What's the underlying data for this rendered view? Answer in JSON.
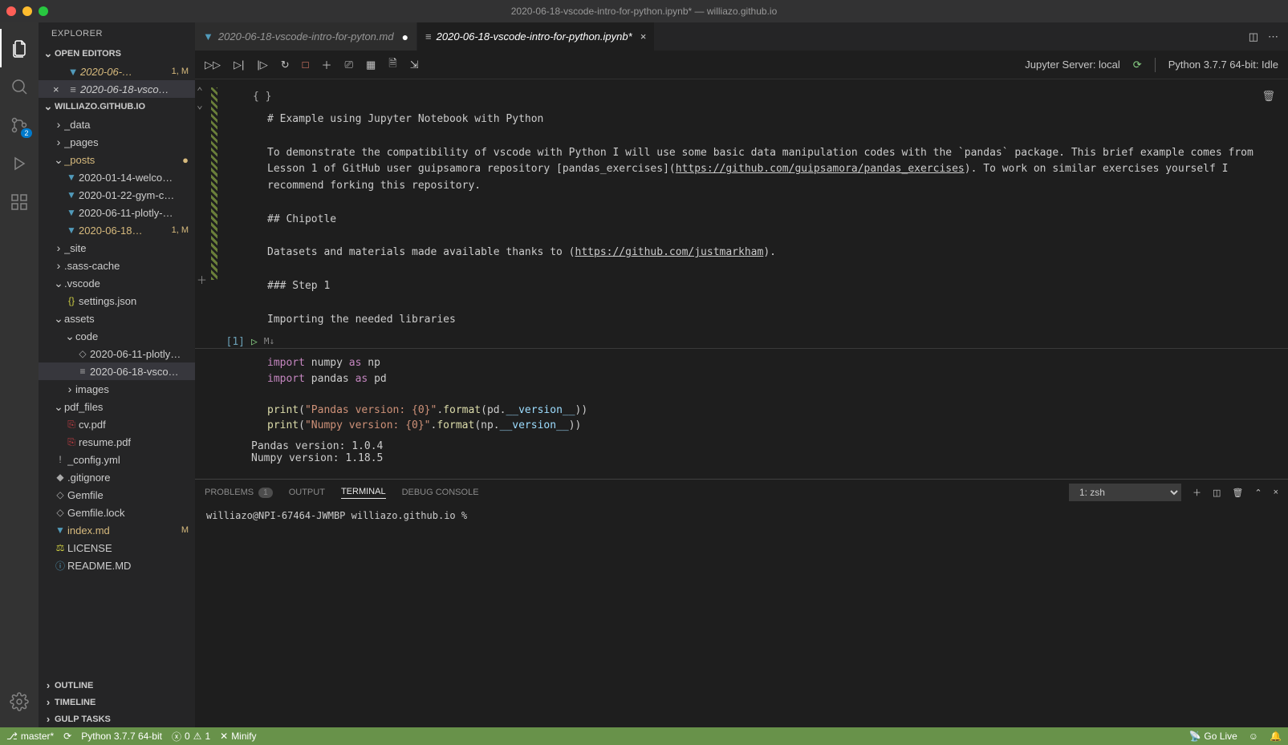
{
  "window": {
    "title": "2020-06-18-vscode-intro-for-python.ipynb* — williazo.github.io"
  },
  "sidebar": {
    "title": "EXPLORER",
    "sections": {
      "open_editors": "OPEN EDITORS",
      "workspace": "WILLIAZO.GITHUB.IO",
      "outline": "OUTLINE",
      "timeline": "TIMELINE",
      "gulp": "GULP TASKS"
    },
    "open_editors": [
      {
        "label": "2020-06-…",
        "badge": "1, M"
      },
      {
        "label": "2020-06-18-vsco…",
        "badge": ""
      }
    ],
    "tree": {
      "data": "_data",
      "pages": "_pages",
      "posts": "_posts",
      "posts_children": [
        "2020-01-14-welco…",
        "2020-01-22-gym-c…",
        "2020-06-11-plotly-…",
        "2020-06-18…"
      ],
      "posts_badge": "1, M",
      "site": "_site",
      "sass": ".sass-cache",
      "vscode": ".vscode",
      "settings": "settings.json",
      "assets": "assets",
      "code": "code",
      "code_children": [
        "2020-06-11-plotly…",
        "2020-06-18-vsco…"
      ],
      "images": "images",
      "pdf": "pdf_files",
      "cv": "cv.pdf",
      "resume": "resume.pdf",
      "config": "_config.yml",
      "gitignore": ".gitignore",
      "gemfile": "Gemfile",
      "gemlock": "Gemfile.lock",
      "index": "index.md",
      "index_badge": "M",
      "license": "LICENSE",
      "readme": "README.MD"
    }
  },
  "tabs": [
    {
      "label": "2020-06-18-vscode-intro-for-pyton.md",
      "active": false,
      "dirty": true
    },
    {
      "label": "2020-06-18-vscode-intro-for-python.ipynb*",
      "active": true,
      "dirty": false
    }
  ],
  "notebook_toolbar": {
    "server": "Jupyter Server: local",
    "kernel": "Python 3.7.7 64-bit: Idle"
  },
  "markdown_cell": {
    "h1": "# Example using Jupyter Notebook with Python",
    "p1a": "To demonstrate the compatibility of vscode with Python I will use some basic data manipulation codes with the `pandas` package. This brief example comes from Lesson 1 of GitHub user guipsamora repository [pandas_exercises](",
    "link1": "https://github.com/guipsamora/pandas_exercises",
    "p1b": "). To work on similar exercises yourself I recommend forking this repository.",
    "h2": "## Chipotle",
    "p2a": "Datasets and materials made available thanks to (",
    "link2": "https://github.com/justmarkham",
    "p2b": ").",
    "h3": "### Step 1",
    "p3": "Importing the needed libraries"
  },
  "code_cell": {
    "exec_count": "[1]",
    "md_indicator": "M↓",
    "lines": {
      "l1": {
        "kw1": "import",
        "v1": " numpy ",
        "kw2": "as",
        "v2": " np"
      },
      "l2": {
        "kw1": "import",
        "v1": " pandas ",
        "kw2": "as",
        "v2": " pd"
      },
      "l3": "",
      "l4": {
        "fn": "print",
        "p1": "(",
        "s": "\"Pandas version: {0}\"",
        "p2": ".",
        "fn2": "format",
        "p3": "(pd.",
        "attr": "__version__",
        "p4": "))"
      },
      "l5": {
        "fn": "print",
        "p1": "(",
        "s": "\"Numpy version: {0}\"",
        "p2": ".",
        "fn2": "format",
        "p3": "(np.",
        "attr": "__version__",
        "p4": "))"
      }
    }
  },
  "output": {
    "l1": "Pandas version: 1.0.4",
    "l2": "Numpy version: 1.18.5"
  },
  "panel": {
    "tabs": {
      "problems": "PROBLEMS",
      "problems_badge": "1",
      "output": "OUTPUT",
      "terminal": "TERMINAL",
      "debug": "DEBUG CONSOLE"
    },
    "terminal_select": "1: zsh",
    "terminal_line": "williazo@NPI-67464-JWMBP williazo.github.io % "
  },
  "statusbar": {
    "branch": "master*",
    "python": "Python 3.7.7 64-bit",
    "errors": "0",
    "warnings": "1",
    "minify": "Minify",
    "golive": "Go Live"
  },
  "scm_badge": "2"
}
